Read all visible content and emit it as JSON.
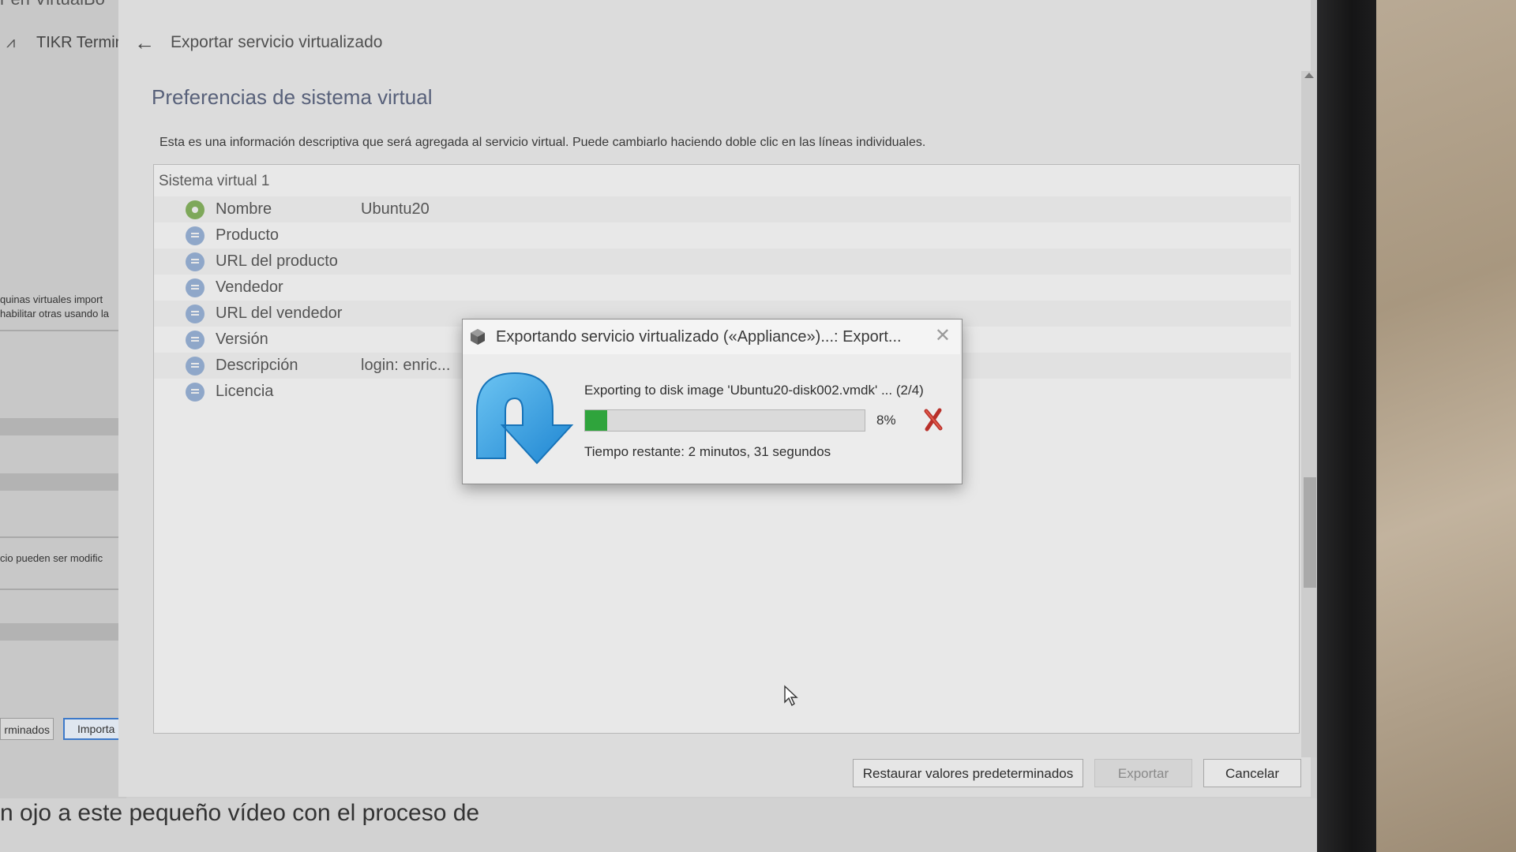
{
  "background_app": {
    "top_text": "r en VirtualBo",
    "tab_title": "TIKR Termin",
    "note_1": "quinas virtuales import",
    "note_2": "habilitar otras usando la",
    "note_3": "cio pueden ser modific",
    "button_left": "rminados",
    "button_right": "Importa",
    "bottom_text": "n ojo a este pequeño vídeo con el proceso de"
  },
  "wizard": {
    "header_title": "Exportar servicio virtualizado",
    "subtitle": "Preferencias de sistema virtual",
    "description": "Esta es una información descriptiva que será agregada al servicio virtual. Puede cambiarlo haciendo doble clic en las líneas individuales.",
    "group_label": "Sistema virtual 1",
    "rows": [
      {
        "label": "Nombre",
        "value": "Ubuntu20",
        "icon": "gear-icon"
      },
      {
        "label": "Producto",
        "value": "",
        "icon": "comment-icon"
      },
      {
        "label": "URL del producto",
        "value": "",
        "icon": "comment-icon"
      },
      {
        "label": "Vendedor",
        "value": "",
        "icon": "comment-icon"
      },
      {
        "label": "URL del vendedor",
        "value": "",
        "icon": "comment-icon"
      },
      {
        "label": "Versión",
        "value": "",
        "icon": "comment-icon"
      },
      {
        "label": "Descripción",
        "value": "login: enric...",
        "icon": "comment-icon"
      },
      {
        "label": "Licencia",
        "value": "",
        "icon": "comment-icon"
      }
    ],
    "buttons": {
      "restore": "Restaurar valores predeterminados",
      "export": "Exportar",
      "cancel": "Cancelar"
    }
  },
  "progress_dialog": {
    "title": "Exportando servicio virtualizado («Appliance»)...: Export...",
    "message": "Exporting to disk image 'Ubuntu20-disk002.vmdk' ... (2/4)",
    "percent_label": "8%",
    "progress_fraction": 0.08,
    "remaining": "Tiempo restante: 2 minutos, 31 segundos"
  },
  "colors": {
    "progress_fill": "#2fa43c",
    "accent_blue": "#3d79c9",
    "cancel_red": "#c0392b"
  }
}
